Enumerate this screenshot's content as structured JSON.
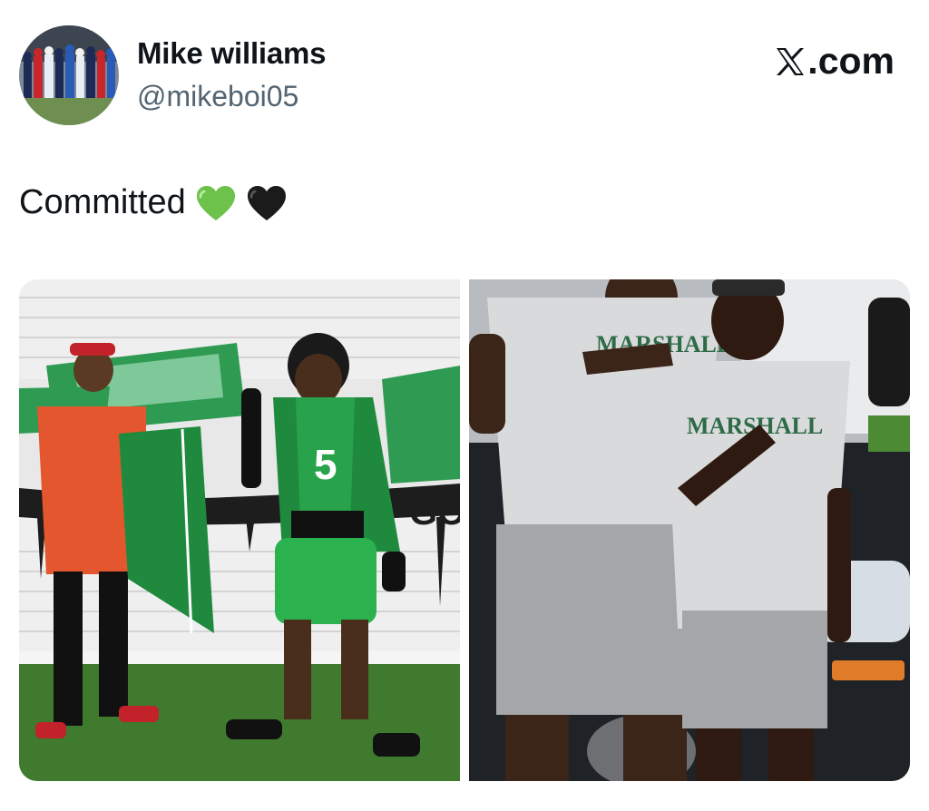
{
  "author": {
    "name": "Mike williams",
    "handle": "@mikeboi05",
    "avatar_icon": "avatar-football-team-photo"
  },
  "brand": {
    "label": ".com",
    "icon": "x-logo-icon"
  },
  "tweet": {
    "text": "Committed",
    "emojis": [
      "green-heart-icon",
      "black-heart-icon"
    ]
  },
  "media": {
    "left_photo": {
      "jersey_number": "5",
      "wall_text": "GO"
    },
    "right_photo": {
      "shirt_text_tall": "MARSHALL",
      "shirt_text_short": "MARSHALL"
    }
  },
  "colors": {
    "marshall_green": "#1f8a3e",
    "text_primary": "#0f1419",
    "text_secondary": "#536471"
  }
}
